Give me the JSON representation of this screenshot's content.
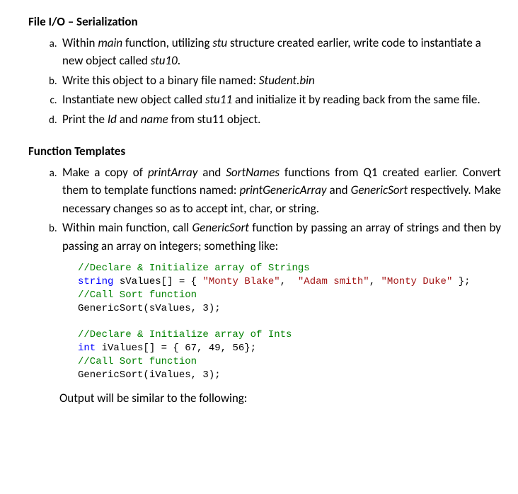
{
  "section1": {
    "heading": "File I/O – Serialization",
    "items": {
      "a_pre": "Within ",
      "a_i1": "main",
      "a_mid1": " function, utilizing ",
      "a_i2": "stu",
      "a_mid2": " structure created earlier, write code to instantiate a new object called ",
      "a_i3": "stu10",
      "a_post": ".",
      "b_pre": "Write this object to a binary file named: ",
      "b_i1": "Student.bin",
      "c_pre": "Instantiate new object called ",
      "c_i1": "stu11",
      "c_post": " and initialize it by reading back from the same file.",
      "d_pre": "Print the ",
      "d_i1": "Id",
      "d_mid": " and ",
      "d_i2": "name",
      "d_post": " from stu11 object."
    }
  },
  "section2": {
    "heading": "Function Templates",
    "items": {
      "a_pre": "Make a copy of ",
      "a_i1": "printArray",
      "a_mid1": " and ",
      "a_i2": "SortNames",
      "a_mid2": " functions from Q1 created earlier.  Convert them to template functions named: ",
      "a_i3": "printGenericArray",
      "a_mid3": " and ",
      "a_i4": "GenericSort",
      "a_post": " respectively.  Make necessary changes so as to accept int, char, or string.",
      "b_pre": "Within main function, call ",
      "b_i1": "GenericSort",
      "b_post": " function by passing an array of strings and then by passing an array on integers; something like:"
    },
    "output_line": "Output will be similar to the following:"
  },
  "code": {
    "c1": "//Declare & Initialize array of Strings",
    "kw_string": "string",
    "svals": " sValues[] = { ",
    "s_monty_blake": "\"Monty Blake\"",
    "comma_sp": ",  ",
    "s_adam": "\"Adam smith\"",
    "comma": ", ",
    "s_monty_duke": "\"Monty Duke\"",
    "close_arr": " };",
    "c2": "//Call Sort function",
    "call1": "GenericSort(sValues, 3);",
    "c3": "//Declare & Initialize array of Ints",
    "kw_int": "int",
    "ivals": " iValues[] = { 67, 49, 56};",
    "c4": "//Call Sort function",
    "call2": "GenericSort(iValues, 3);"
  }
}
